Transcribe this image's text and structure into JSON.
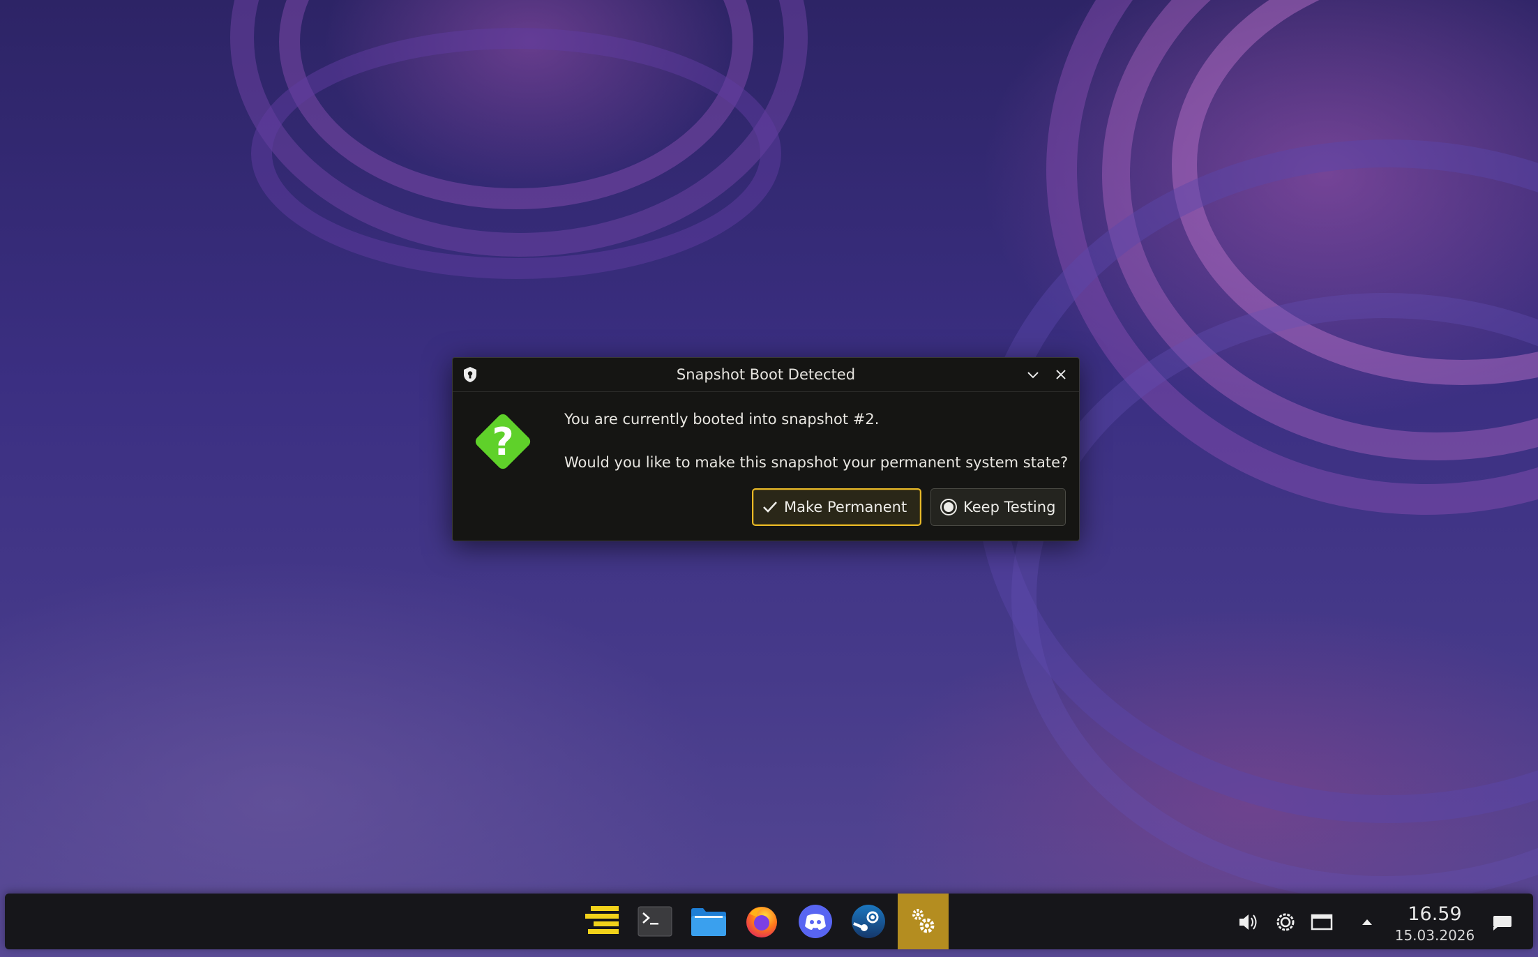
{
  "dialog": {
    "title": "Snapshot Boot Detected",
    "message_line1": "You are currently booted into snapshot #2.",
    "message_line2": "Would you like to make this snapshot your permanent system state?",
    "primary_button": "Make Permanent",
    "secondary_button": "Keep Testing",
    "icon": "question-icon",
    "accent_color": "#e8b928",
    "question_color": "#5fd12a"
  },
  "taskbar": {
    "apps": [
      {
        "name": "app-menu-icon",
        "active": false
      },
      {
        "name": "terminal-icon",
        "active": false
      },
      {
        "name": "file-manager-icon",
        "active": false
      },
      {
        "name": "firefox-icon",
        "active": false
      },
      {
        "name": "discord-icon",
        "active": false
      },
      {
        "name": "steam-icon",
        "active": false
      },
      {
        "name": "snapshot-settings-icon",
        "active": true
      }
    ],
    "tray": [
      "volume-icon",
      "brightness-icon",
      "display-icon",
      "tray-expand-icon",
      "notifications-icon"
    ],
    "clock": {
      "time": "16.59",
      "date": "15.03.2026"
    },
    "active_color": "#b48d20"
  }
}
